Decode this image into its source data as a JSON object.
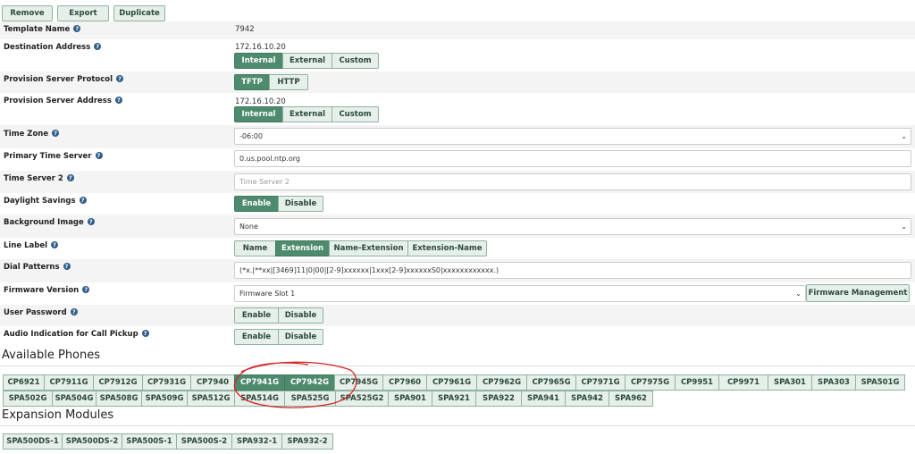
{
  "toolbar": {
    "remove": "Remove",
    "export": "Export",
    "duplicate": "Duplicate"
  },
  "fields": {
    "template_name": {
      "label": "Template Name",
      "value": "7942"
    },
    "destination_address": {
      "label": "Destination Address",
      "value": "172.16.10.20",
      "options": [
        "Internal",
        "External",
        "Custom"
      ],
      "selected": "Internal"
    },
    "provision_protocol": {
      "label": "Provision Server Protocol",
      "options": [
        "TFTP",
        "HTTP"
      ],
      "selected": "TFTP"
    },
    "provision_address": {
      "label": "Provision Server Address",
      "value": "172.16.10.20",
      "options": [
        "Internal",
        "External",
        "Custom"
      ],
      "selected": "Internal"
    },
    "time_zone": {
      "label": "Time Zone",
      "value": "-06:00"
    },
    "primary_time_server": {
      "label": "Primary Time Server",
      "value": "0.us.pool.ntp.org"
    },
    "time_server_2": {
      "label": "Time Server 2",
      "placeholder": "Time Server 2"
    },
    "daylight_savings": {
      "label": "Daylight Savings",
      "options": [
        "Enable",
        "Disable"
      ],
      "selected": "Enable"
    },
    "background_image": {
      "label": "Background Image",
      "value": "None"
    },
    "line_label": {
      "label": "Line Label",
      "options": [
        "Name",
        "Extension",
        "Name-Extension",
        "Extension-Name"
      ],
      "selected": "Extension"
    },
    "dial_patterns": {
      "label": "Dial Patterns",
      "value": "(*x.|**xx|[3469]11|0|00|[2-9]xxxxxx|1xxx[2-9]xxxxxxS0|xxxxxxxxxxxx.)"
    },
    "firmware_version": {
      "label": "Firmware Version",
      "value": "Firmware Slot 1",
      "button": "Firmware Management"
    },
    "user_password": {
      "label": "User Password",
      "options": [
        "Enable",
        "Disable"
      ],
      "selected": "Enable"
    },
    "audio_indication": {
      "label": "Audio Indication for Call Pickup",
      "options": [
        "Enable",
        "Disable"
      ],
      "selected": "Enable"
    }
  },
  "available_phones": {
    "title": "Available Phones",
    "row1": [
      "CP6921",
      "CP7911G",
      "CP7912G",
      "CP7931G",
      "CP7940",
      "CP7941G",
      "CP7942G",
      "CP7945G",
      "CP7960",
      "CP7961G",
      "CP7962G",
      "CP7965G",
      "CP7971G",
      "CP7975G",
      "CP9951",
      "CP9971",
      "SPA301",
      "SPA303",
      "SPA501G"
    ],
    "row2": [
      "SPA502G",
      "SPA504G",
      "SPA508G",
      "SPA509G",
      "SPA512G",
      "SPA514G",
      "SPA525G",
      "SPA525G2",
      "SPA901",
      "SPA921",
      "SPA922",
      "SPA941",
      "SPA942",
      "SPA962"
    ],
    "selected": [
      "CP7941G",
      "CP7942G"
    ]
  },
  "expansion_modules": {
    "title": "Expansion Modules",
    "items": [
      "SPA500DS-1",
      "SPA500DS-2",
      "SPA500S-1",
      "SPA500S-2",
      "SPA932-1",
      "SPA932-2"
    ]
  },
  "colors": {
    "accent": "#4e8a6d",
    "button_bg": "#e6efea",
    "annotation": "#d62020"
  }
}
